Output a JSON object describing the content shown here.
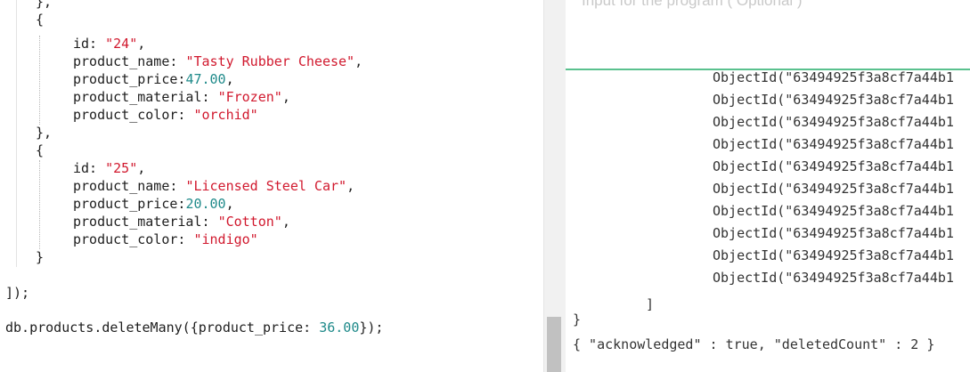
{
  "editor": {
    "lines": [
      {
        "indent": 1,
        "tokens": [
          {
            "t": "p",
            "v": "},"
          }
        ]
      },
      {
        "indent": 1,
        "tokens": [
          {
            "t": "p",
            "v": "{"
          }
        ]
      },
      {
        "indent": 2,
        "tokens": [
          {
            "t": "k",
            "v": "id: "
          },
          {
            "t": "s",
            "v": "\"24\""
          },
          {
            "t": "p",
            "v": ","
          }
        ]
      },
      {
        "indent": 2,
        "tokens": [
          {
            "t": "k",
            "v": "product_name: "
          },
          {
            "t": "s",
            "v": "\"Tasty Rubber Cheese\""
          },
          {
            "t": "p",
            "v": ","
          }
        ]
      },
      {
        "indent": 2,
        "tokens": [
          {
            "t": "k",
            "v": "product_price:"
          },
          {
            "t": "n",
            "v": "47.00"
          },
          {
            "t": "p",
            "v": ","
          }
        ]
      },
      {
        "indent": 2,
        "tokens": [
          {
            "t": "k",
            "v": "product_material: "
          },
          {
            "t": "s",
            "v": "\"Frozen\""
          },
          {
            "t": "p",
            "v": ","
          }
        ]
      },
      {
        "indent": 2,
        "tokens": [
          {
            "t": "k",
            "v": "product_color: "
          },
          {
            "t": "s",
            "v": "\"orchid\""
          }
        ]
      },
      {
        "indent": 1,
        "tokens": [
          {
            "t": "p",
            "v": "},"
          }
        ]
      },
      {
        "indent": 1,
        "tokens": [
          {
            "t": "p",
            "v": "{"
          }
        ]
      },
      {
        "indent": 2,
        "tokens": [
          {
            "t": "k",
            "v": "id: "
          },
          {
            "t": "s",
            "v": "\"25\""
          },
          {
            "t": "p",
            "v": ","
          }
        ]
      },
      {
        "indent": 2,
        "tokens": [
          {
            "t": "k",
            "v": "product_name: "
          },
          {
            "t": "s",
            "v": "\"Licensed Steel Car\""
          },
          {
            "t": "p",
            "v": ","
          }
        ]
      },
      {
        "indent": 2,
        "tokens": [
          {
            "t": "k",
            "v": "product_price:"
          },
          {
            "t": "n",
            "v": "20.00"
          },
          {
            "t": "p",
            "v": ","
          }
        ]
      },
      {
        "indent": 2,
        "tokens": [
          {
            "t": "k",
            "v": "product_material: "
          },
          {
            "t": "s",
            "v": "\"Cotton\""
          },
          {
            "t": "p",
            "v": ","
          }
        ]
      },
      {
        "indent": 2,
        "tokens": [
          {
            "t": "k",
            "v": "product_color: "
          },
          {
            "t": "s",
            "v": "\"indigo\""
          }
        ]
      },
      {
        "indent": 1,
        "tokens": [
          {
            "t": "p",
            "v": "}"
          }
        ]
      },
      {
        "indent": 0,
        "tokens": []
      },
      {
        "indent": 0,
        "tokens": [
          {
            "t": "p",
            "v": "]);"
          }
        ]
      },
      {
        "indent": 0,
        "tokens": []
      },
      {
        "indent": 0,
        "tokens": [
          {
            "t": "k",
            "v": "db.products.deleteMany({product_price: "
          },
          {
            "t": "n",
            "v": "36.00"
          },
          {
            "t": "p",
            "v": "});"
          }
        ]
      }
    ]
  },
  "stdin": {
    "placeholder": "Input for the program ( Optional )"
  },
  "output": {
    "object_ids": [
      "ObjectId(\"63494925f3a8cf7a44b1",
      "ObjectId(\"63494925f3a8cf7a44b1",
      "ObjectId(\"63494925f3a8cf7a44b1",
      "ObjectId(\"63494925f3a8cf7a44b1",
      "ObjectId(\"63494925f3a8cf7a44b1",
      "ObjectId(\"63494925f3a8cf7a44b1",
      "ObjectId(\"63494925f3a8cf7a44b1",
      "ObjectId(\"63494925f3a8cf7a44b1",
      "ObjectId(\"63494925f3a8cf7a44b1",
      "ObjectId(\"63494925f3a8cf7a44b1"
    ],
    "closing_bracket": "]",
    "closing_brace": "}",
    "result": "{ \"acknowledged\" : true, \"deletedCount\" : 2 }"
  },
  "colors": {
    "string": "#d1192e",
    "number": "#1f8a8a",
    "text": "#1e1e1e",
    "divider_accent": "#5ac18e",
    "placeholder": "#c9c9c9"
  }
}
